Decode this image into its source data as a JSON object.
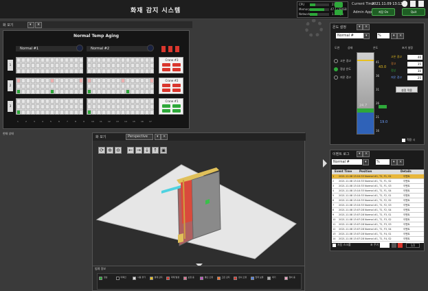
{
  "header": {
    "title": "화재 감지 시스템",
    "current_time_label": "Current Time",
    "current_time": "2021.11.09 13:12:24",
    "user": "Admin App",
    "buttons": [
      "저장 On",
      "Quit"
    ]
  },
  "stats": [
    {
      "name": "CPU",
      "value": "27%"
    },
    {
      "name": "Memory",
      "value": "47.1 / 64GB"
    },
    {
      "name": "Network",
      "value": "1.2Mbps"
    }
  ],
  "left_panel": {
    "toolbar_label": "화 모기",
    "heading": "Normal Temp Aging",
    "groups": [
      {
        "name": "Normal #1"
      },
      {
        "name": "Normal #2"
      }
    ],
    "rows": [
      "1",
      "2",
      "3"
    ],
    "x_ticks": [
      "1",
      "2",
      "3",
      "4",
      "5",
      "6",
      "7",
      "8",
      "9",
      "10",
      "11",
      "12",
      "13",
      "14",
      "15",
      "16",
      "17"
    ],
    "cranes": [
      "Crane #3",
      "Crane #2",
      "Crane #1"
    ],
    "footer": "현재 상태"
  },
  "view3d": {
    "label": "화 모기",
    "mode": "Perspective",
    "tools": [
      "⟳",
      "⊕",
      "⊖",
      "←",
      "→",
      "↓",
      "↑",
      "▣"
    ]
  },
  "legend": {
    "title": "범례 정보",
    "items": [
      "정상",
      "미확인",
      "사용 불가",
      "경계 감지",
      "화재 발생",
      "보정 중",
      "통신 오류",
      "고온 감지",
      "센서 오류",
      "입력 보류",
      "대기",
      "정비 중"
    ]
  },
  "right_top": {
    "title": "온도 설정",
    "select": "Normal #",
    "columns": [
      "도연",
      "상태",
      "온도",
      "초기 설정"
    ],
    "options": [
      "고온 경고",
      "정상 온도",
      "저온 경고"
    ],
    "scale": [
      "41",
      "36",
      "31",
      "26",
      "21",
      "16"
    ],
    "value_high": "43.0",
    "value_mid": "24.7",
    "value_low": "19.0",
    "inputs": [
      "40",
      "35",
      "30",
      "25"
    ],
    "side_labels": [
      "고온 경고",
      "경고",
      "정상",
      "저온 경고"
    ],
    "apply": "설정 적용",
    "footer": "적용 시"
  },
  "right_bottom": {
    "title": "이벤트 로그",
    "select": "Normal #",
    "columns": [
      "Event Time",
      "Position",
      "Details"
    ],
    "rows": [
      [
        "1",
        "2021.11.08 13:10:33",
        "Normal #1, T1, F1, S1",
        "이벤트"
      ],
      [
        "2",
        "2021.11.08 13:10:33",
        "Normal #1, T1, F1, S2",
        "이벤트"
      ],
      [
        "3",
        "2021.11.08 13:10:33",
        "Normal #1, T1, F1, S3",
        "이벤트"
      ],
      [
        "4",
        "2021.11.08 13:10:33",
        "Normal #1, T1, F1, S4",
        "이벤트"
      ],
      [
        "5",
        "2021.11.08 13:10:33",
        "Normal #1, T1, F2, S1",
        "이벤트"
      ],
      [
        "6",
        "2021.11.08 13:10:33",
        "Normal #1, T1, F2, S2",
        "이벤트"
      ],
      [
        "7",
        "2021.11.08 13:10:33",
        "Normal #1, T1, F2, S3",
        "이벤트"
      ],
      [
        "8",
        "2021.11.08 13:07:28",
        "Normal #1, T1, F2, S4",
        "이벤트"
      ],
      [
        "9",
        "2021.11.08 13:07:28",
        "Normal #1, T1, F3, S1",
        "이벤트"
      ],
      [
        "10",
        "2021.11.08 13:07:28",
        "Normal #1, T1, F3, S2",
        "이벤트"
      ],
      [
        "11",
        "2021.11.08 13:07:28",
        "Normal #1, T1, F3, S3",
        "이벤트"
      ],
      [
        "12",
        "2021.11.08 13:07:28",
        "Normal #1, T1, F3, S4",
        "이벤트"
      ],
      [
        "13",
        "2021.11.08 13:07:28",
        "Normal #1, T1, F4, S1",
        "이벤트"
      ],
      [
        "14",
        "2021.11.08 13:07:28",
        "Normal #1, T1, F4, S2",
        "이벤트"
      ]
    ],
    "footer_left": "자동 스크롤",
    "footer_mid": "초 주기",
    "page": "1/2"
  },
  "colors": {
    "accent_green": "#2ea83a",
    "alarm_red": "#d9362d",
    "panel_bg": "#1b1b1b",
    "header_bg": "#202020",
    "selected_row": "#e8b73c",
    "gauge_blue": "#2f62b8"
  }
}
